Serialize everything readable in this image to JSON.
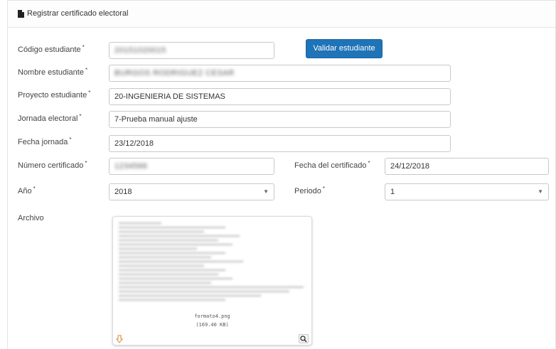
{
  "header": {
    "title": "Registrar certificado electoral",
    "icon": "file-icon"
  },
  "form": {
    "codigo": {
      "label": "Código estudiante",
      "required": "*",
      "value": "20151020015"
    },
    "validar_button": "Validar estudiante",
    "nombre": {
      "label": "Nombre estudiante",
      "required": "*",
      "value": "BURGOS RODRIGUEZ CESAR"
    },
    "proyecto": {
      "label": "Proyecto estudiante",
      "required": "*",
      "value": "20-INGENIERIA DE SISTEMAS"
    },
    "jornada": {
      "label": "Jornada electoral",
      "required": "*",
      "value": "7-Prueba manual ajuste"
    },
    "fecha_jornada": {
      "label": "Fecha jornada",
      "required": "*",
      "value": "23/12/2018"
    },
    "numero": {
      "label": "Número certificado",
      "required": "*",
      "value": "1234566"
    },
    "fecha_certificado": {
      "label": "Fecha del certificado",
      "required": "*",
      "value": "24/12/2018"
    },
    "anio": {
      "label": "Año",
      "required": "*",
      "value": "2018"
    },
    "periodo": {
      "label": "Periodo",
      "required": "*",
      "value": "1"
    },
    "archivo": {
      "label": "Archivo"
    }
  },
  "file_preview": {
    "filename": "formato4.png",
    "size": "(169.40 KB)"
  },
  "colors": {
    "primary_button": "#1f73b7",
    "border": "#c8c8c8"
  }
}
